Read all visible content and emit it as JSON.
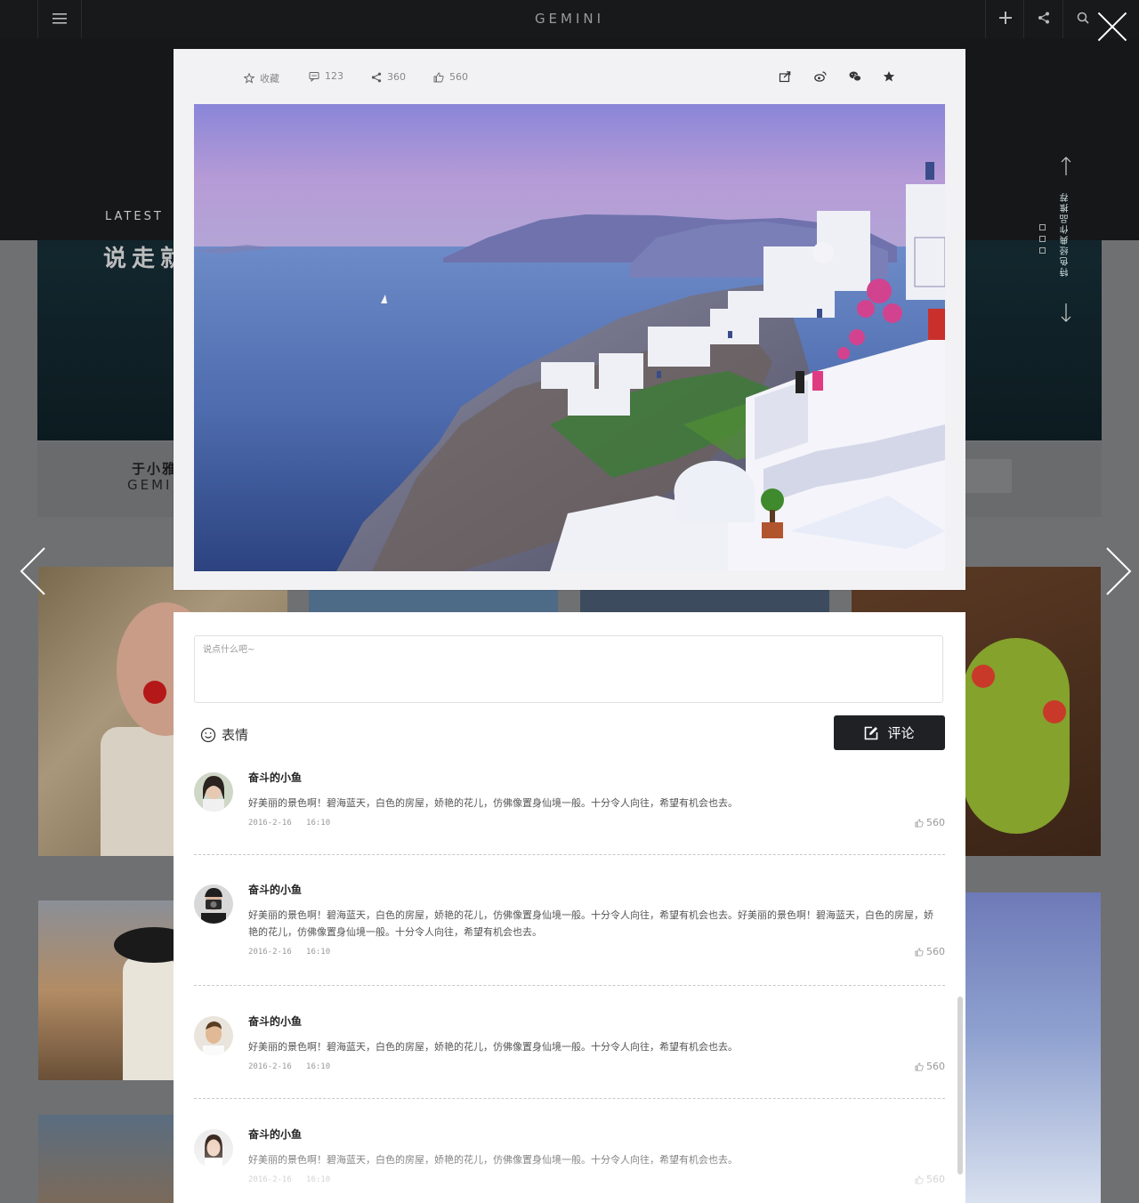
{
  "header": {
    "brand": "GEMINI",
    "menu_icon": "hamburger-icon",
    "actions": [
      {
        "name": "add",
        "icon": "plus-icon"
      },
      {
        "name": "share",
        "icon": "share-icon"
      },
      {
        "name": "search",
        "icon": "search-icon"
      }
    ]
  },
  "hero": {
    "eyebrow": "LATEST",
    "title": "说走就",
    "side_label": "特色经典作品推荐"
  },
  "author": {
    "name": "于小雅",
    "brand": "GEMI"
  },
  "modal": {
    "toolbar": {
      "favorite_label": "收藏",
      "comments_count": "123",
      "shares_count": "360",
      "likes_count": "560",
      "share_targets": [
        "export-icon",
        "weibo-icon",
        "wechat-icon",
        "star-icon"
      ]
    },
    "comment_form": {
      "placeholder": "说点什么吧~",
      "emoji_label": "表情",
      "submit_label": "评论"
    },
    "comments": [
      {
        "author": "奋斗的小鱼",
        "text": "好美丽的景色啊！碧海蓝天，白色的房屋，娇艳的花儿，仿佛像置身仙境一般。十分令人向往，希望有机会也去。",
        "date": "2016-2-16",
        "time": "16:10",
        "likes": "560"
      },
      {
        "author": "奋斗的小鱼",
        "text": "好美丽的景色啊！碧海蓝天，白色的房屋，娇艳的花儿，仿佛像置身仙境一般。十分令人向往，希望有机会也去。好美丽的景色啊！碧海蓝天，白色的房屋，娇艳的花儿，仿佛像置身仙境一般。十分令人向往，希望有机会也去。",
        "date": "2016-2-16",
        "time": "16:10",
        "likes": "560"
      },
      {
        "author": "奋斗的小鱼",
        "text": "好美丽的景色啊！碧海蓝天，白色的房屋，娇艳的花儿，仿佛像置身仙境一般。十分令人向往，希望有机会也去。",
        "date": "2016-2-16",
        "time": "16:10",
        "likes": "560"
      },
      {
        "author": "奋斗的小鱼",
        "text": "好美丽的景色啊！碧海蓝天，白色的房屋，娇艳的花儿，仿佛像置身仙境一般。十分令人向往，希望有机会也去。",
        "date": "2016-2-16",
        "time": "16:10",
        "likes": "560"
      }
    ]
  },
  "colors": {
    "overlay": "#6f7072",
    "topbar": "#18191b",
    "button_dark": "#1f2124",
    "modal_bg": "#f2f2f4"
  }
}
